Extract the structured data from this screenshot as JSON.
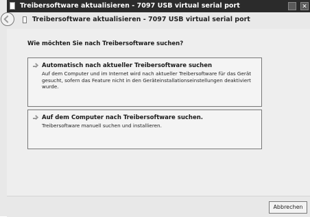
{
  "window": {
    "title": "Treibersoftware aktualisieren - 7097 USB virtual serial port",
    "help_icon": "help-icon",
    "close_label": "✕"
  },
  "header": {
    "back_icon": "back-arrow-icon",
    "device_icon": "device-icon",
    "title": "Treibersoftware aktualisieren - 7097 USB virtual serial port"
  },
  "main": {
    "question": "Wie möchten Sie nach Treibersoftware suchen?",
    "options": [
      {
        "icon": "arrow-right-icon",
        "title": "Automatisch nach aktueller Treibersoftware suchen",
        "description": "Auf dem Computer und im Internet wird nach aktueller Treibersoftware für das Gerät gesucht, sofern das Feature nicht in den Geräteinstallationseinstellungen deaktiviert wurde."
      },
      {
        "icon": "arrow-right-icon",
        "title": "Auf dem Computer nach Treibersoftware suchen.",
        "description": "Treibersoftware manuell suchen und installieren."
      }
    ]
  },
  "footer": {
    "cancel_label": "Abbrechen"
  }
}
